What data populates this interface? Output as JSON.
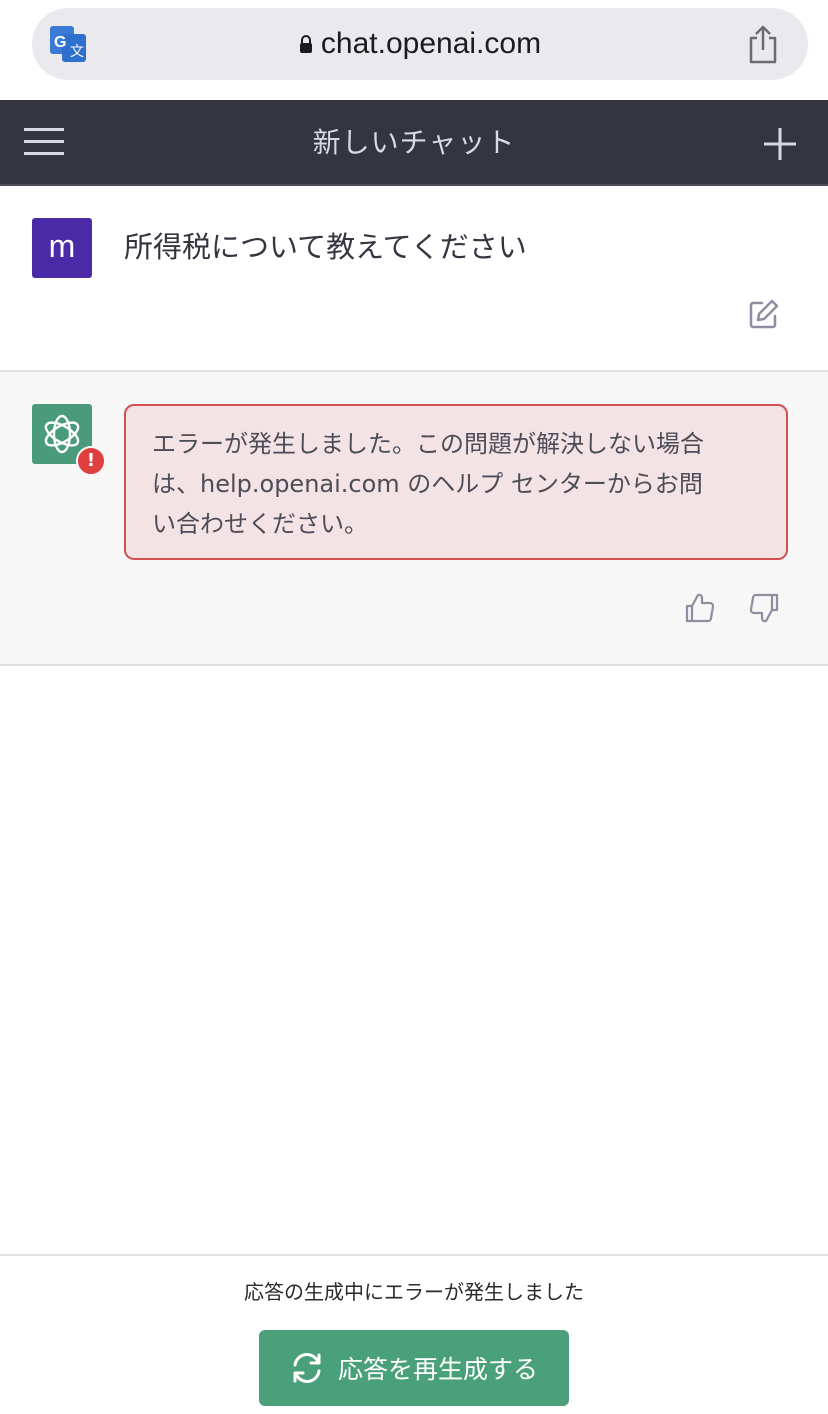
{
  "browser": {
    "url": "chat.openai.com",
    "icons": {
      "translate": "translate-icon",
      "lock": "lock-icon",
      "share": "share-icon"
    }
  },
  "header": {
    "title": "新しいチャット",
    "icons": {
      "menu": "hamburger-menu-icon",
      "new_chat": "plus-icon"
    }
  },
  "conversation": {
    "user": {
      "avatar_letter": "m",
      "message": "所得税について教えてください"
    },
    "assistant": {
      "error_badge": "!",
      "error_lines": [
        "エラーが発生しました。この問題が解決しない場合",
        "は、help.openai.com のヘルプ センターからお問",
        "い合わせください。"
      ]
    }
  },
  "footer": {
    "status_text": "応答の生成中にエラーが発生しました",
    "regenerate_label": "応答を再生成する"
  },
  "colors": {
    "header_bg": "#343541",
    "user_avatar": "#4b2aa8",
    "bot_avatar": "#4a9a7c",
    "error_border": "#d0514f",
    "error_bg": "#f3e3e5",
    "button_bg": "#4ba07c"
  }
}
